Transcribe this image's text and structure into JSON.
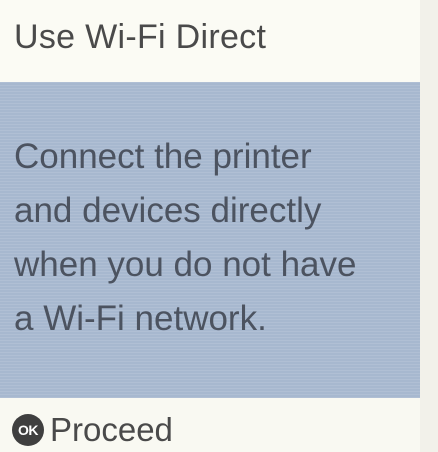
{
  "header": {
    "title": "Use Wi-Fi Direct"
  },
  "message": {
    "lines": [
      "Connect the printer",
      "and devices directly",
      "when you do not have",
      "a Wi-Fi network."
    ]
  },
  "footer": {
    "ok_glyph": "OK",
    "proceed_label": "Proceed"
  },
  "colors": {
    "panel_background": "#a7b8cf",
    "header_background": "#fbfbf4",
    "text": "#4a4a4a"
  },
  "icons": {
    "ok_button": "ok-button-icon"
  }
}
